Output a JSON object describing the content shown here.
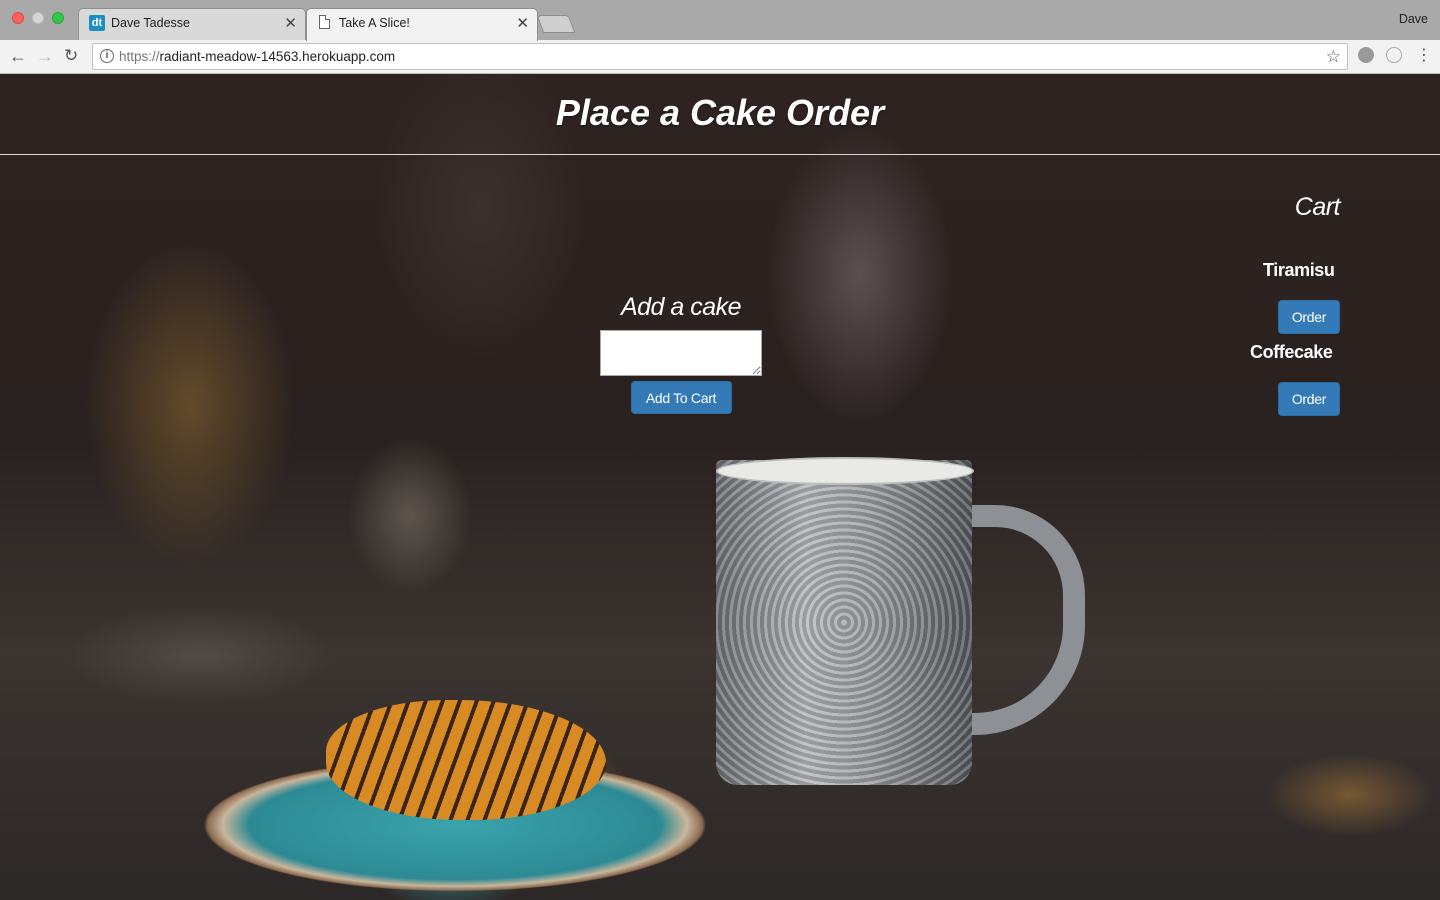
{
  "browser": {
    "tabs": [
      {
        "title": "Dave Tadesse",
        "favicon": "dt"
      },
      {
        "title": "Take A Slice!",
        "favicon": "document-icon"
      }
    ],
    "profile_name": "Dave",
    "url_scheme": "https://",
    "url_host": "radiant-meadow-14563.herokuapp.com"
  },
  "header": {
    "title": "Place a Cake Order"
  },
  "add_cake": {
    "heading": "Add a cake",
    "input_value": "",
    "button_label": "Add To Cart"
  },
  "cart": {
    "title": "Cart",
    "items": [
      {
        "name": "Tiramisu",
        "button_label": "Order"
      },
      {
        "name": "Coffecake",
        "button_label": "Order"
      }
    ]
  },
  "colors": {
    "button_primary": "#337ab7",
    "text": "#ffffff"
  }
}
